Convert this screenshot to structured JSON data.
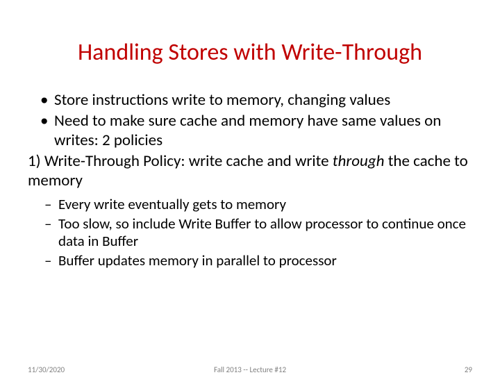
{
  "title": "Handling Stores with Write-Through",
  "bullets": {
    "b1": "Store instructions write to memory, changing values",
    "b2": "Need to make sure cache and memory have same values on writes: 2 policies",
    "b3_prefix": "1) Write-Through Policy: write cache and write ",
    "b3_italic": "through",
    "b3_suffix": " the cache to memory",
    "s1": "Every write eventually gets to memory",
    "s2": "Too slow, so include Write Buffer to allow processor to continue once data in Buffer",
    "s3": "Buffer updates memory in parallel to processor"
  },
  "footer": {
    "date": "11/30/2020",
    "center": "Fall 2013 -- Lecture #12",
    "page": "29"
  }
}
